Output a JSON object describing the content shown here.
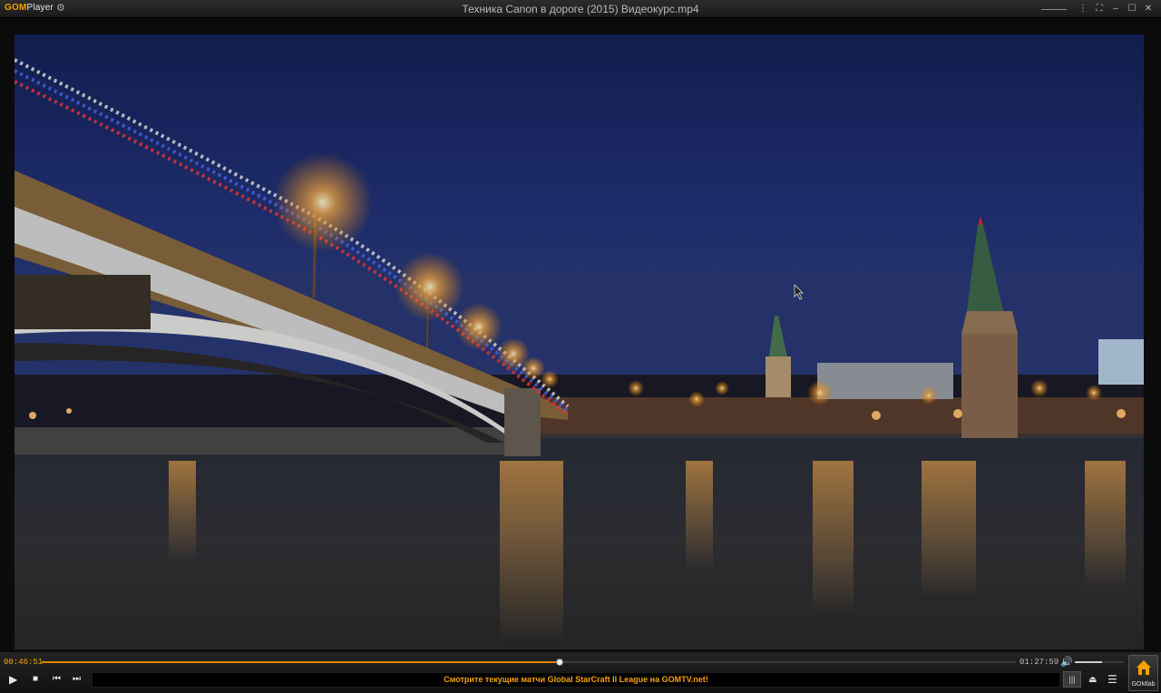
{
  "app": {
    "logo_gom": "GOM",
    "logo_player": "Player",
    "window_title": "Техника Canon в дороге (2015) Видеокурс.mp4"
  },
  "playback": {
    "current_time": "00:46:51",
    "total_time": "01:27:59",
    "progress_fraction": 0.532,
    "volume_fraction": 0.55
  },
  "ticker": {
    "text": "Смотрите текущие матчи Global StarCraft II League на GOMTV.net!"
  },
  "gomlab": {
    "label": "GOMlab"
  },
  "colors": {
    "accent": "#f5a300",
    "background": "#111111"
  }
}
